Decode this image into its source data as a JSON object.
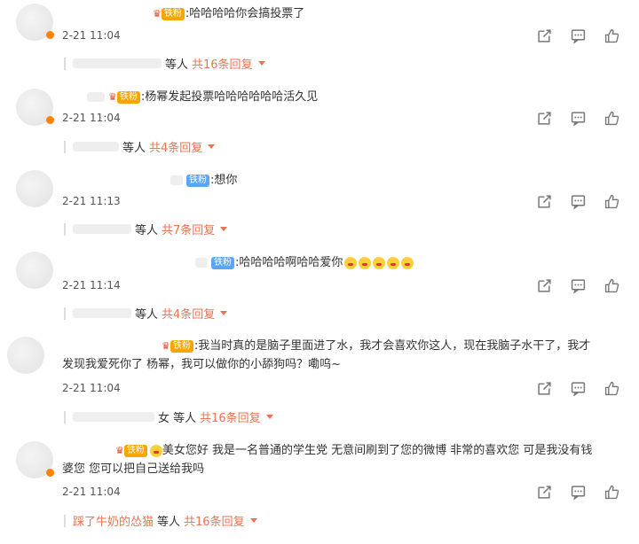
{
  "comments": [
    {
      "badge": "铁粉",
      "text": ":哈哈哈哈你会搞投票了",
      "time": "2-21 11:04",
      "reply_prefix": "等人",
      "reply_count": "共16条回复"
    },
    {
      "badge": "铁粉",
      "text": ":杨幂发起投票哈哈哈哈哈哈活久见",
      "time": "2-21 11:04",
      "reply_prefix": "等人",
      "reply_count": "共4条回复"
    },
    {
      "badge": "铁粉",
      "text": ":想你",
      "time": "2-21 11:13",
      "reply_prefix": "等人",
      "reply_count": "共7条回复"
    },
    {
      "badge": "铁粉",
      "text": ":哈哈哈哈啊哈哈爱你",
      "time": "2-21 11:14",
      "reply_prefix": "等人",
      "reply_count": "共4条回复"
    },
    {
      "badge": "铁粉",
      "text_line1": ":我当时真的是脑子里面进了水，我才会喜欢你这人，现在我脑子水干了，我才",
      "text_line2": "发现我爱死你了 杨幂，我可以做你的小舔狗吗？嘞呜~",
      "time": "2-21 11:04",
      "reply_prefix": "女 等人",
      "reply_count": "共16条回复"
    },
    {
      "badge": "铁粉",
      "text_line1": "美女您好 我是一名普通的学生党 无意间刷到了您的微博 非常的喜欢您 可是我没有钱",
      "text_line2": "婆您 您可以把自己送给我吗",
      "time": "2-21 11:04",
      "reply_nick": "踩了牛奶的怂猫",
      "reply_prefix": "等人",
      "reply_count": "共16条回复"
    }
  ],
  "icons": {
    "share": "share-icon",
    "comment": "comment-icon",
    "like": "like-icon"
  },
  "colors": {
    "accent": "#eb7350",
    "badge_gold": "#f7a600",
    "badge_blue": "#5aa6f5"
  }
}
